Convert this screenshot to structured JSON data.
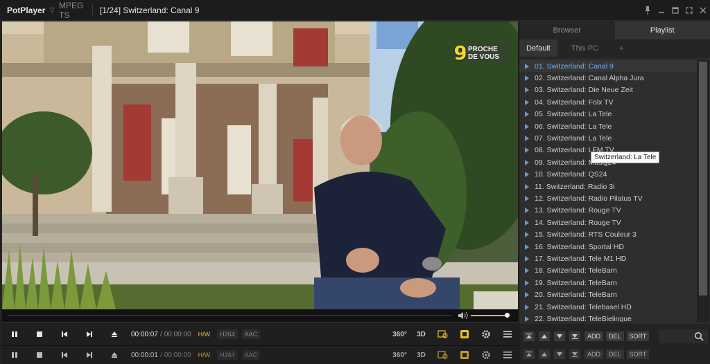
{
  "titlebar": {
    "app_name": "PotPlayer",
    "format": "MPEG TS",
    "title": "[1/24] Switzerland: Canal 9",
    "icons": [
      "pin-icon",
      "compact-icon",
      "minimize-icon",
      "maximize-icon",
      "close-icon"
    ]
  },
  "video": {
    "channel_logo_number": "9",
    "channel_logo_text": "Proche de vous"
  },
  "seek": {
    "progress": 0.0,
    "volume": 1.0
  },
  "controls": {
    "time_current": "00:00:07",
    "time_separator": "/",
    "time_total": "00:00:00",
    "badges": [
      "H/W",
      "H264",
      "AAC"
    ],
    "right_icons": [
      "360-icon",
      "3d-icon",
      "capture-icon",
      "subtitle-icon",
      "settings-icon",
      "menu-icon"
    ],
    "label_360": "360°",
    "label_3d": "3D"
  },
  "controls_ghost": {
    "time_current": "00:00:01",
    "time_total": "00:00:00"
  },
  "panel": {
    "tabs": [
      {
        "label": "Browser",
        "active": false
      },
      {
        "label": "Playlist",
        "active": true
      }
    ],
    "list_tabs": [
      {
        "label": "Default",
        "active": true
      },
      {
        "label": "This PC",
        "active": false
      },
      {
        "label": "+",
        "active": false
      }
    ],
    "playlist": [
      "01. Switzerland: Canal 9",
      "02. Switzerland: Canal Alpha Jura",
      "03. Switzerland: Die Neue Zeit",
      "04. Switzerland: Folx TV",
      "05. Switzerland: La Tele",
      "06. Switzerland: La Tele",
      "07. Switzerland: La Tele",
      "08. Switzerland: LFM TV",
      "09. Switzerland: Musig24",
      "10. Switzerland: QS24",
      "11. Switzerland: Radio 3i",
      "12. Switzerland: Radio Pilatus TV",
      "13. Switzerland: Rouge TV",
      "14. Switzerland: Rouge TV",
      "15. Switzerland: RTS Couleur 3",
      "16. Switzerland: Sportal HD",
      "17. Switzerland: Tele M1 HD",
      "18. Switzerland: TeleBarn",
      "19. Switzerland: TeleBarn",
      "20. Switzerland: TeleBarn",
      "21. Switzerland: Telebasel HD",
      "22. Switzerland: TeleBielingue"
    ],
    "current_index": 0,
    "tooltip": "Switzerland: La Tele",
    "footer_buttons": [
      "ADD",
      "DEL",
      "SORT"
    ]
  },
  "colors": {
    "accent": "#f0c020",
    "playing": "#6fb1f0",
    "background": "#232323"
  }
}
